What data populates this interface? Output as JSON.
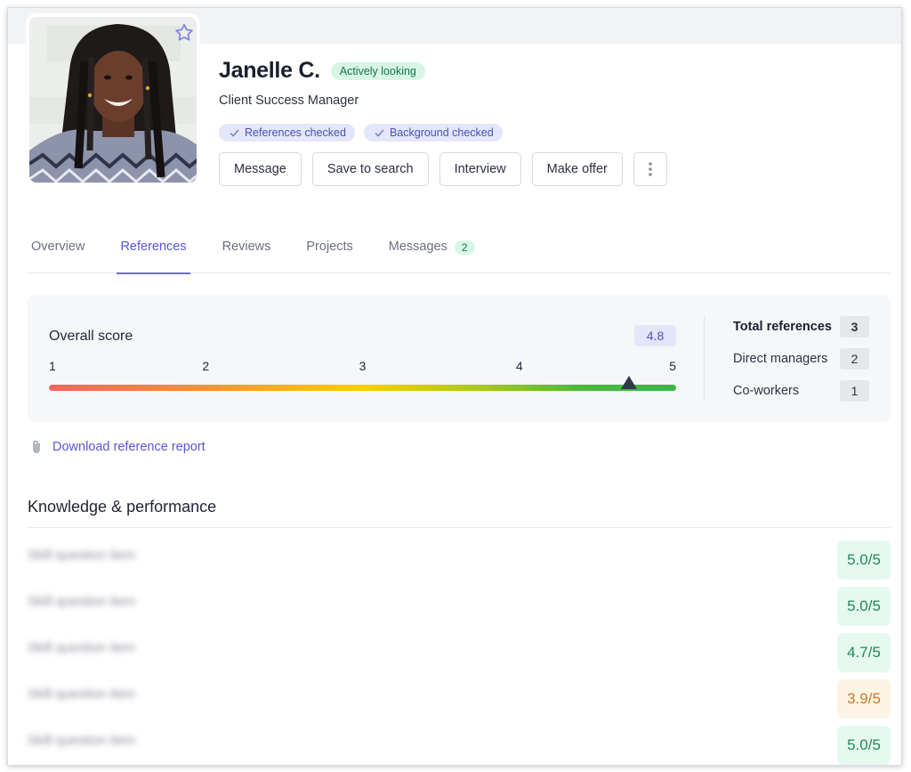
{
  "profile": {
    "name": "Janelle C.",
    "status": "Actively looking",
    "job_title": "Client Success Manager",
    "favorite_icon": "star-outline-icon",
    "verifications": [
      {
        "label": "References checked",
        "icon": "check-icon"
      },
      {
        "label": "Background checked",
        "icon": "check-icon"
      }
    ],
    "actions": [
      {
        "label": "Message"
      },
      {
        "label": "Save to search"
      },
      {
        "label": "Interview"
      },
      {
        "label": "Make offer"
      }
    ],
    "more_icon": "more-vertical-icon"
  },
  "tabs": [
    {
      "label": "Overview",
      "active": false
    },
    {
      "label": "References",
      "active": true
    },
    {
      "label": "Reviews",
      "active": false
    },
    {
      "label": "Projects",
      "active": false
    },
    {
      "label": "Messages",
      "active": false,
      "badge": "2"
    }
  ],
  "overall_score": {
    "label": "Overall score",
    "value": 4.8,
    "value_text": "4.8",
    "scale_min": 1,
    "scale_max": 5,
    "ticks": [
      "1",
      "2",
      "3",
      "4",
      "5"
    ]
  },
  "references": {
    "total_label": "Total references",
    "total": "3",
    "breakdown": [
      {
        "label": "Direct managers",
        "count": "2"
      },
      {
        "label": "Co-workers",
        "count": "1"
      }
    ]
  },
  "download": {
    "label": "Download reference report",
    "icon": "paperclip-icon"
  },
  "knowledge": {
    "title": "Knowledge & performance",
    "items": [
      {
        "label": "Skill question item",
        "score": "5.0/5",
        "level": "good"
      },
      {
        "label": "Skill question item",
        "score": "5.0/5",
        "level": "good"
      },
      {
        "label": "Skill question item",
        "score": "4.7/5",
        "level": "good"
      },
      {
        "label": "Skill question item",
        "score": "3.9/5",
        "level": "mid"
      },
      {
        "label": "Skill question item",
        "score": "5.0/5",
        "level": "good"
      }
    ]
  },
  "colors": {
    "accent": "#5a55d6",
    "success": "#1f8a55",
    "warning": "#c9782e"
  }
}
